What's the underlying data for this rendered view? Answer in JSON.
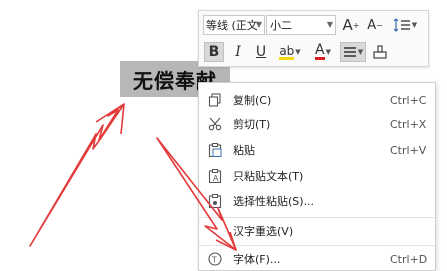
{
  "selected_text": "无偿奉献",
  "toolbar": {
    "font_name": "等线 (正文",
    "font_size": "小二",
    "grow_font": "A",
    "shrink_font": "A",
    "bold": "B",
    "italic": "I",
    "underline": "U",
    "highlight": "ab",
    "font_color": "A"
  },
  "menu": {
    "items": [
      {
        "label": "复制(C)",
        "shortcut": "Ctrl+C",
        "icon": "copy-icon"
      },
      {
        "label": "剪切(T)",
        "shortcut": "Ctrl+X",
        "icon": "scissors-icon"
      },
      {
        "label": "粘贴",
        "shortcut": "Ctrl+V",
        "icon": "paste-icon"
      },
      {
        "label": "只粘贴文本(T)",
        "shortcut": "",
        "icon": "paste-text-icon"
      },
      {
        "label": "选择性粘贴(S)...",
        "shortcut": "",
        "icon": "paste-special-icon"
      },
      {
        "label": "汉字重选(V)",
        "shortcut": "",
        "icon": ""
      },
      {
        "label": "字体(F)...",
        "shortcut": "Ctrl+D",
        "icon": "font-icon"
      }
    ]
  },
  "colors": {
    "highlight": "#f5d90a",
    "font_color": "#e02020",
    "arrow": "#e33b3b",
    "selection": "#b7b7b7"
  }
}
